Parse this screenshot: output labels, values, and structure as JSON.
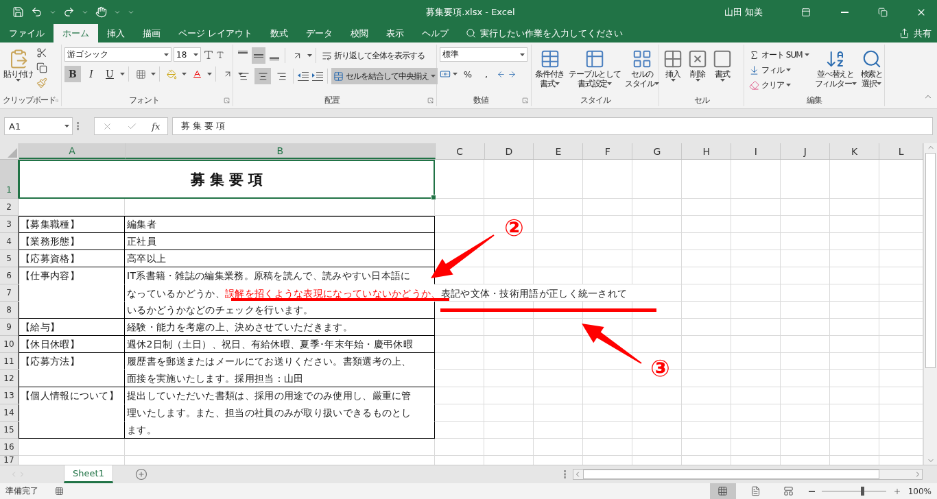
{
  "title_bar": {
    "title": "募集要項.xlsx  -  Excel",
    "user": "山田 知美"
  },
  "tabs": [
    {
      "label": "ファイル",
      "selected": false
    },
    {
      "label": "ホーム",
      "selected": true
    },
    {
      "label": "挿入",
      "selected": false
    },
    {
      "label": "描画",
      "selected": false
    },
    {
      "label": "ページ レイアウト",
      "selected": false
    },
    {
      "label": "数式",
      "selected": false
    },
    {
      "label": "データ",
      "selected": false
    },
    {
      "label": "校閲",
      "selected": false
    },
    {
      "label": "表示",
      "selected": false
    },
    {
      "label": "ヘルプ",
      "selected": false
    }
  ],
  "tell_me": {
    "placeholder": "実行したい作業を入力してください"
  },
  "share": "共有",
  "ribbon": {
    "clipboard": {
      "label": "クリップボード",
      "paste": "貼り付け"
    },
    "font": {
      "label": "フォント",
      "name": "游ゴシック",
      "size": "18",
      "styles": [
        {
          "text": "B",
          "selected": true
        },
        {
          "text": "I",
          "selected": false
        },
        {
          "text": "U",
          "selected": false
        }
      ]
    },
    "alignment": {
      "label": "配置",
      "wrap": "折り返して全体を表示する",
      "merge": "セルを結合して中央揃え",
      "merge_selected": true,
      "vertical": [
        {
          "selected": false
        },
        {
          "selected": true
        },
        {
          "selected": false
        }
      ],
      "horizontal": [
        {
          "selected": false
        },
        {
          "selected": true
        },
        {
          "selected": false
        }
      ]
    },
    "number": {
      "label": "数値",
      "format": "標準",
      "percent": "%",
      "comma": ","
    },
    "styles": {
      "label": "スタイル",
      "buttons": [
        {
          "lines": [
            "条件付き",
            "書式"
          ]
        },
        {
          "lines": [
            "テーブルとして",
            "書式設定"
          ]
        },
        {
          "lines": [
            "セルの",
            "スタイル"
          ]
        }
      ]
    },
    "cells": {
      "label": "セル",
      "buttons": [
        "挿入",
        "削除",
        "書式"
      ]
    },
    "editing": {
      "label": "編集",
      "items": [
        "オート SUM",
        "フィル",
        "クリア"
      ],
      "buttons": [
        {
          "lines": [
            "並べ替えと",
            "フィルター"
          ]
        },
        {
          "lines": [
            "検索と",
            "選択"
          ]
        }
      ]
    }
  },
  "formula_bar": {
    "name_box": "A1",
    "function_label": "fx",
    "content": "募 集 要 項"
  },
  "sheet": {
    "columns": [
      {
        "label": "A",
        "selected": true
      },
      {
        "label": "B",
        "selected": true
      },
      {
        "label": "C",
        "selected": false
      },
      {
        "label": "D",
        "selected": false
      },
      {
        "label": "E",
        "selected": false
      },
      {
        "label": "F",
        "selected": false
      },
      {
        "label": "G",
        "selected": false
      },
      {
        "label": "H",
        "selected": false
      },
      {
        "label": "I",
        "selected": false
      },
      {
        "label": "J",
        "selected": false
      },
      {
        "label": "K",
        "selected": false
      },
      {
        "label": "L",
        "selected": false
      }
    ],
    "row_numbers": [
      {
        "label": "1",
        "selected": true
      },
      {
        "label": "2",
        "selected": false
      },
      {
        "label": "3",
        "selected": false
      },
      {
        "label": "4",
        "selected": false
      },
      {
        "label": "5",
        "selected": false
      },
      {
        "label": "6",
        "selected": false
      },
      {
        "label": "7",
        "selected": false
      },
      {
        "label": "8",
        "selected": false
      },
      {
        "label": "9",
        "selected": false
      },
      {
        "label": "10",
        "selected": false
      },
      {
        "label": "11",
        "selected": false
      },
      {
        "label": "12",
        "selected": false
      },
      {
        "label": "13",
        "selected": false
      },
      {
        "label": "14",
        "selected": false
      },
      {
        "label": "15",
        "selected": false
      },
      {
        "label": "16",
        "selected": false
      },
      {
        "label": "17",
        "selected": false
      }
    ],
    "title": "募 集 要 項",
    "entries": [
      {
        "label": "【募集職種】",
        "lines": [
          [
            {
              "text": "編集者",
              "emphasis": false
            }
          ]
        ]
      },
      {
        "label": "【業務形態】",
        "lines": [
          [
            {
              "text": "正社員",
              "emphasis": false
            }
          ]
        ]
      },
      {
        "label": "【応募資格】",
        "lines": [
          [
            {
              "text": "高卒以上",
              "emphasis": false
            }
          ]
        ]
      },
      {
        "label": "【仕事内容】",
        "lines": [
          [
            {
              "text": "IT系書籍・雑誌の編集業務。原稿を読んで、読みやすい日本語に",
              "emphasis": false
            }
          ],
          [
            {
              "text": "なっているかどうか、",
              "emphasis": false
            },
            {
              "text": "誤解を招くような表現になっていないかどうか、",
              "emphasis": true
            },
            {
              "text": "表記や文体・技術用語が正しく統一されて",
              "emphasis": false
            }
          ],
          [
            {
              "text": "いるかどうかなどのチェックを行います。",
              "emphasis": false
            }
          ]
        ]
      },
      {
        "label": "【給与】",
        "lines": [
          [
            {
              "text": "経験・能力を考慮の上、決めさせていただきます。",
              "emphasis": false
            }
          ]
        ]
      },
      {
        "label": "【休日休暇】",
        "lines": [
          [
            {
              "text": "週休2日制（土日）、祝日、有給休暇、夏季･年末年始・慶弔休暇",
              "emphasis": false
            }
          ]
        ]
      },
      {
        "label": "【応募方法】",
        "lines": [
          [
            {
              "text": "履歴書を郵送またはメールにてお送りください。書類選考の上、",
              "emphasis": false
            }
          ],
          [
            {
              "text": "面接を実施いたします。採用担当：山田",
              "emphasis": false
            }
          ]
        ]
      },
      {
        "label": "【個人情報について】",
        "lines": [
          [
            {
              "text": "提出していただいた書類は、採用の用途でのみ使用し、厳重に管",
              "emphasis": false
            }
          ],
          [
            {
              "text": "理いたします。また、担当の社員のみが取り扱いできるものとし",
              "emphasis": false
            }
          ],
          [
            {
              "text": "ます。",
              "emphasis": false
            }
          ]
        ]
      }
    ]
  },
  "annotations": [
    {
      "label": "②"
    },
    {
      "label": "③"
    }
  ],
  "sheet_tabs": [
    {
      "label": "Sheet1",
      "selected": true
    }
  ],
  "status_bar": {
    "status": "準備完了",
    "zoom": "100%",
    "zoom_slider": {
      "level": 0.64
    }
  }
}
